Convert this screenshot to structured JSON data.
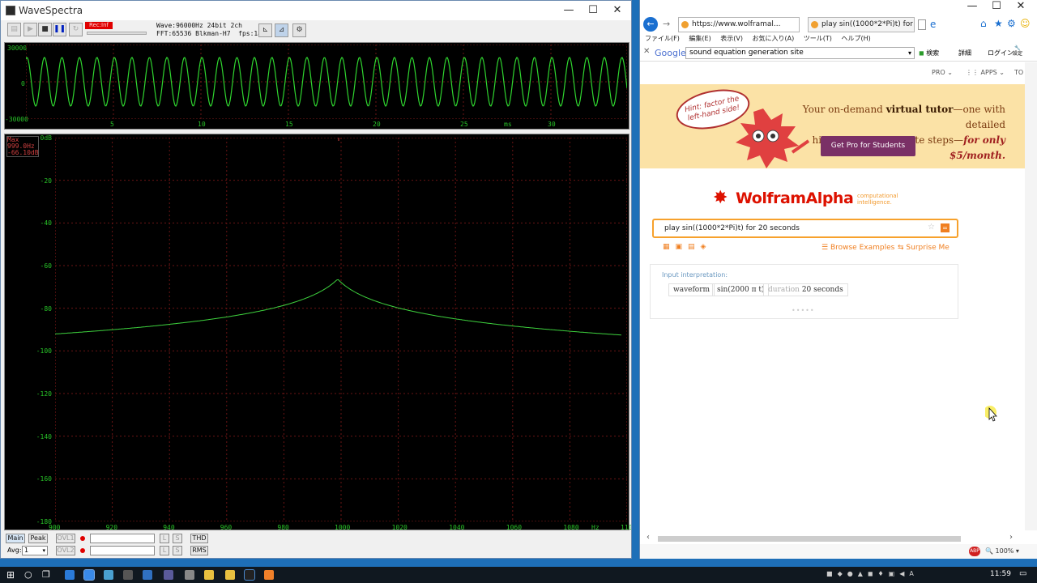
{
  "wavespectra": {
    "title": "WaveSpectra",
    "rec_label": "Rec:Inf",
    "wave_info": "Wave:96000Hz 24bit 2ch",
    "fft_info": "FFT:65536 Blkman-H7  fps:186",
    "scope": {
      "y_labels": [
        "30000",
        "0",
        "-30000"
      ],
      "x_labels": [
        "5",
        "10",
        "15",
        "20",
        "25",
        "30"
      ],
      "x_unit": "ms"
    },
    "spectrum": {
      "max_label": "Max",
      "max_freq": "999.0Hz",
      "max_db": "-66.10dB",
      "y_labels": [
        "0dB",
        "-20",
        "-40",
        "-60",
        "-80",
        "-100",
        "-120",
        "-140",
        "-160",
        "-180"
      ],
      "x_labels": [
        "900",
        "920",
        "940",
        "960",
        "980",
        "1000",
        "1020",
        "1040",
        "1060",
        "1080",
        "1100"
      ],
      "x_unit": "Hz"
    },
    "bottom": {
      "main": "Main",
      "peak": "Peak",
      "ovl1": "OVL1",
      "ovl2": "OVL2",
      "avg_label": "Avg:",
      "avg_value": "1",
      "l": "L",
      "s": "S",
      "thd": "THD",
      "rms": "RMS"
    }
  },
  "browser": {
    "tab1": "https://www.wolframal...",
    "tab2": "play sin((1000*2*Pi)t) for 20 ...",
    "menu": [
      "ファイル(F)",
      "編集(E)",
      "表示(V)",
      "お気に入り(A)",
      "ツール(T)",
      "ヘルプ(H)"
    ],
    "google_label": "Google",
    "google_query": "sound equation generation site",
    "search_btn": "検索",
    "details_btn": "詳細",
    "login_btn": "ログイン",
    "settings_btn": "設定",
    "wa_nav": [
      "PRO",
      "APPS",
      "TO"
    ],
    "promo": {
      "hint": "Hint: factor the left-hand side!",
      "line1_pre": "Your on-demand ",
      "line1_bold": "virtual tutor",
      "line1_post": "—one with detailed",
      "line2_pre": "hints and intermediate steps—",
      "line2_bold": "for only $5/month.",
      "cta": "Get Pro for Students"
    },
    "logo_main": "WolframAlpha",
    "logo_tag1": "computational",
    "logo_tag2": "intelligence.",
    "query": "play sin((1000*2*Pi)t) for 20 seconds",
    "browse": "Browse Examples",
    "surprise": "Surprise Me",
    "input_interp": "Input interpretation:",
    "pill1": "waveform",
    "pill2": "sin(2000 π t)",
    "pill3_label": "duration",
    "pill3_value": "20 seconds",
    "zoom": "100%"
  },
  "taskbar": {
    "clock": "11:59"
  }
}
